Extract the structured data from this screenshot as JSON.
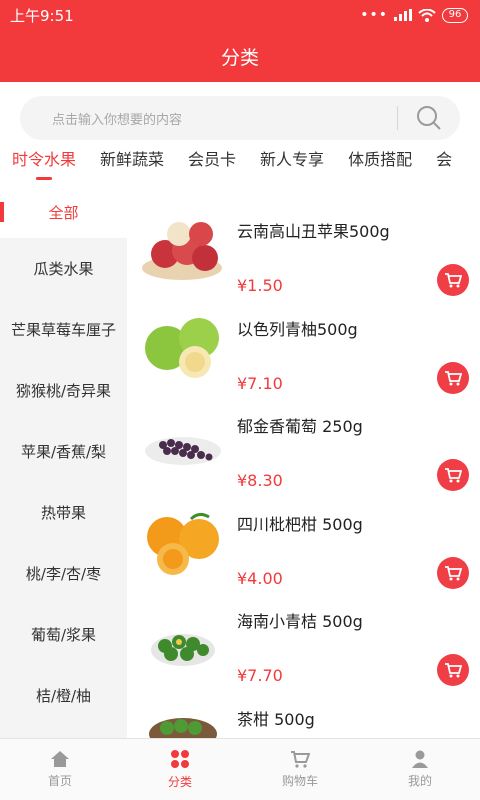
{
  "status": {
    "time": "上午9:51",
    "battery": "96"
  },
  "header": {
    "title": "分类"
  },
  "search": {
    "placeholder": "点击输入你想要的内容"
  },
  "tabs": [
    "时令水果",
    "新鲜蔬菜",
    "会员卡",
    "新人专享",
    "体质搭配",
    "会"
  ],
  "sidebar": {
    "active": "全部",
    "items": [
      "瓜类水果",
      "芒果草莓车厘子",
      "猕猴桃/奇异果",
      "苹果/香蕉/梨",
      "热带果",
      "桃/李/杏/枣",
      "葡萄/浆果",
      "桔/橙/柚"
    ]
  },
  "products": [
    {
      "name": "云南高山丑苹果500g",
      "price": "¥1.50",
      "icon": "apple"
    },
    {
      "name": "以色列青柚500g",
      "price": "¥7.10",
      "icon": "pomelo"
    },
    {
      "name": "郁金香葡萄 250g",
      "price": "¥8.30",
      "icon": "grape"
    },
    {
      "name": "四川枇杷柑 500g",
      "price": "¥4.00",
      "icon": "orange"
    },
    {
      "name": "海南小青桔 500g",
      "price": "¥7.70",
      "icon": "green-tangerine"
    },
    {
      "name": "茶柑 500g",
      "price": "",
      "icon": "tea-tangerine"
    }
  ],
  "tabbar": [
    "首页",
    "分类",
    "购物车",
    "我的"
  ],
  "colors": {
    "brand": "#f23a3c"
  }
}
